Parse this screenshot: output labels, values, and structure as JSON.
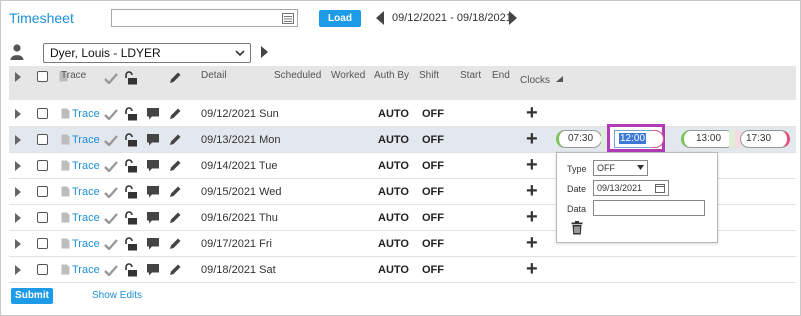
{
  "header": {
    "title": "Timesheet",
    "search_value": "",
    "load_label": "Load",
    "date_range": "09/12/2021 - 09/18/2021"
  },
  "employee": {
    "selected": "Dyer, Louis - LDYER"
  },
  "columns": {
    "trace": "Trace",
    "detail": "Detail",
    "scheduled": "Scheduled",
    "worked": "Worked",
    "auth_by": "Auth By",
    "shift": "Shift",
    "start": "Start",
    "end": "End",
    "clocks": "Clocks"
  },
  "rows": [
    {
      "trace": "Trace",
      "date": "09/12/2021 Sun",
      "auth": "AUTO",
      "shift": "OFF"
    },
    {
      "trace": "Trace",
      "date": "09/13/2021 Mon",
      "auth": "AUTO",
      "shift": "OFF"
    },
    {
      "trace": "Trace",
      "date": "09/14/2021 Tue",
      "auth": "AUTO",
      "shift": "OFF"
    },
    {
      "trace": "Trace",
      "date": "09/15/2021 Wed",
      "auth": "AUTO",
      "shift": "OFF"
    },
    {
      "trace": "Trace",
      "date": "09/16/2021 Thu",
      "auth": "AUTO",
      "shift": "OFF"
    },
    {
      "trace": "Trace",
      "date": "09/17/2021 Fri",
      "auth": "AUTO",
      "shift": "OFF"
    },
    {
      "trace": "Trace",
      "date": "09/18/2021 Sat",
      "auth": "AUTO",
      "shift": "OFF"
    }
  ],
  "clocks": {
    "pair1": {
      "in": "07:30",
      "out": "12:00"
    },
    "pair2": {
      "in": "13:00",
      "out": "17:30"
    }
  },
  "popup": {
    "type_label": "Type",
    "type_value": "OFF",
    "date_label": "Date",
    "date_value": "09/13/2021",
    "data_label": "Data",
    "data_value": ""
  },
  "footer": {
    "submit_label": "Submit",
    "show_edits_label": "Show Edits"
  },
  "colors": {
    "accent": "#1e9be6",
    "link": "#1e90d6",
    "selected_row": "#e3e7ee",
    "clock_in_edge": "#7cc45a",
    "clock_out_edge": "#e0507a",
    "focus_outline": "#b23bb8"
  },
  "icons": {
    "trace": "document-icon",
    "approve": "checkmark-icon",
    "lock": "unlock-icon",
    "comment": "comment-icon",
    "edit": "pencil-icon",
    "add": "plus-icon",
    "person": "person-icon",
    "calendar": "calendar-icon",
    "delete": "trash-icon"
  }
}
